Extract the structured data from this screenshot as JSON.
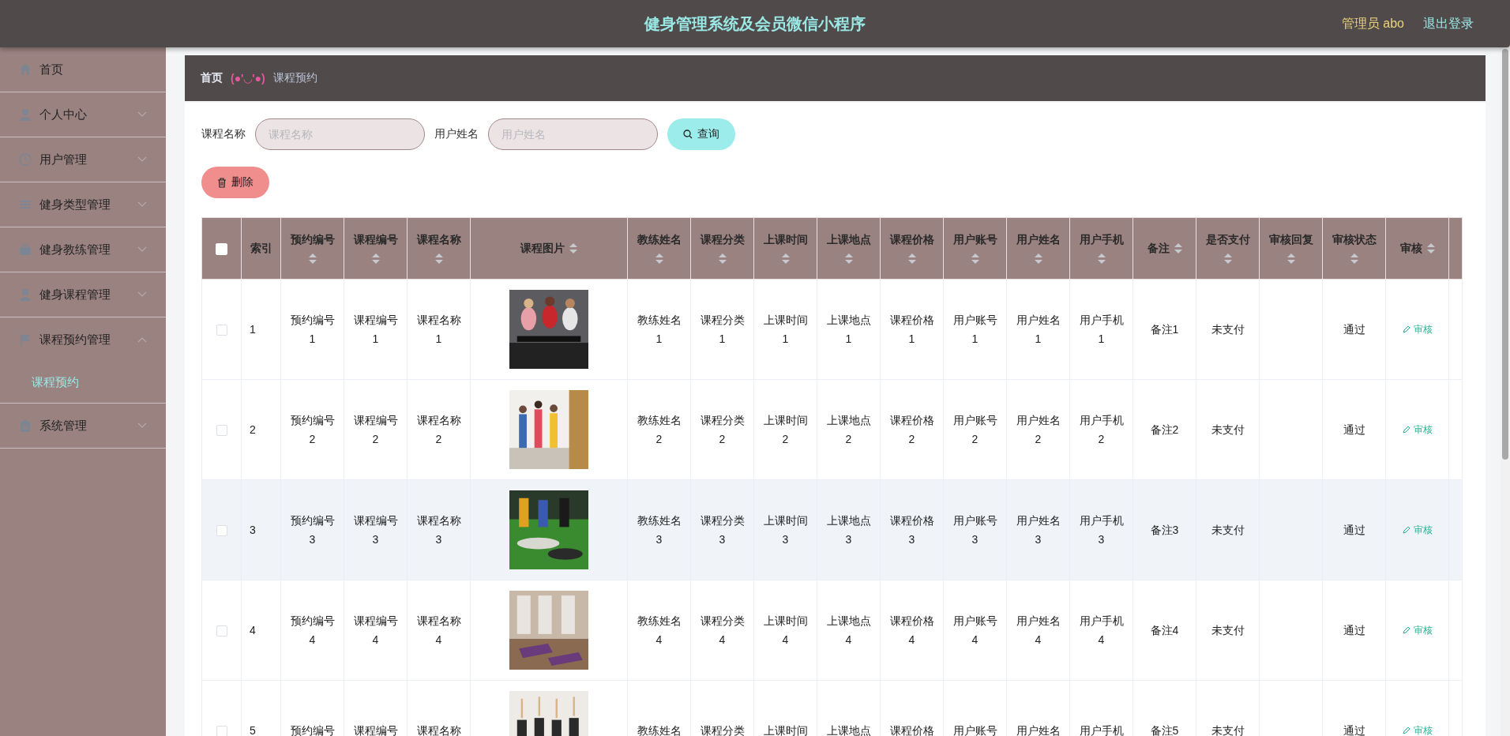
{
  "header": {
    "title": "健身管理系统及会员微信小程序",
    "user": "管理员 abo",
    "logout": "退出登录"
  },
  "sidebar": {
    "items": [
      {
        "label": "首页",
        "kind": "link"
      },
      {
        "label": "个人中心",
        "kind": "menu",
        "expanded": false
      },
      {
        "label": "用户管理",
        "kind": "menu",
        "expanded": false
      },
      {
        "label": "健身类型管理",
        "kind": "menu",
        "expanded": false
      },
      {
        "label": "健身教练管理",
        "kind": "menu",
        "expanded": false
      },
      {
        "label": "健身课程管理",
        "kind": "menu",
        "expanded": false
      },
      {
        "label": "课程预约管理",
        "kind": "menu",
        "expanded": true,
        "children": [
          {
            "label": "课程预约",
            "selected": true
          }
        ]
      },
      {
        "label": "系统管理",
        "kind": "menu",
        "expanded": false
      }
    ]
  },
  "breadcrumb": {
    "home": "首页",
    "separator": "(●'◡'●)",
    "current": "课程预约"
  },
  "search": {
    "fields": [
      {
        "label": "课程名称",
        "placeholder": "课程名称"
      },
      {
        "label": "用户姓名",
        "placeholder": "用户姓名"
      }
    ],
    "button": "查询"
  },
  "actions": {
    "delete": "删除"
  },
  "table": {
    "select_all_checked": false,
    "columns": [
      {
        "kind": "select"
      },
      {
        "kind": "text",
        "label": "索引",
        "sortable": false
      },
      {
        "kind": "text",
        "label": "预约编号",
        "sortable": true
      },
      {
        "kind": "text",
        "label": "课程编号",
        "sortable": true
      },
      {
        "kind": "text",
        "label": "课程名称",
        "sortable": true
      },
      {
        "kind": "picture",
        "label": "课程图片",
        "sortable": true
      },
      {
        "kind": "text",
        "label": "教练姓名",
        "sortable": true
      },
      {
        "kind": "text",
        "label": "课程分类",
        "sortable": true
      },
      {
        "kind": "text",
        "label": "上课时间",
        "sortable": true
      },
      {
        "kind": "text",
        "label": "上课地点",
        "sortable": true
      },
      {
        "kind": "text",
        "label": "课程价格",
        "sortable": true
      },
      {
        "kind": "text",
        "label": "用户账号",
        "sortable": true
      },
      {
        "kind": "text",
        "label": "用户姓名",
        "sortable": true
      },
      {
        "kind": "text",
        "label": "用户手机",
        "sortable": true
      },
      {
        "kind": "text",
        "label": "备注",
        "sortable": true
      },
      {
        "kind": "text",
        "label": "是否支付",
        "sortable": true
      },
      {
        "kind": "text",
        "label": "审核回复",
        "sortable": true
      },
      {
        "kind": "text",
        "label": "审核状态",
        "sortable": true
      },
      {
        "kind": "action",
        "label": "审核",
        "sortable": true
      }
    ],
    "rows": [
      {
        "checked": false,
        "hovered": false,
        "cells": [
          null,
          "1",
          "预约编号 1",
          "课程编号 1",
          "课程名称 1",
          {
            "kind": "picture"
          },
          "教练姓名 1",
          "课程分类 1",
          "上课时间 1",
          "上课地点 1",
          "课程价格 1",
          "用户账号 1",
          "用户姓名 1",
          "用户手机 1",
          "备注1",
          "未支付",
          null,
          "通过",
          "审核"
        ]
      },
      {
        "checked": false,
        "hovered": false,
        "cells": [
          null,
          "2",
          "预约编号 2",
          "课程编号 2",
          "课程名称 2",
          {
            "kind": "picture"
          },
          "教练姓名 2",
          "课程分类 2",
          "上课时间 2",
          "上课地点 2",
          "课程价格 2",
          "用户账号 2",
          "用户姓名 2",
          "用户手机 2",
          "备注2",
          "未支付",
          null,
          "通过",
          "审核"
        ]
      },
      {
        "checked": false,
        "hovered": true,
        "cells": [
          null,
          "3",
          "预约编号 3",
          "课程编号 3",
          "课程名称 3",
          {
            "kind": "picture"
          },
          "教练姓名 3",
          "课程分类 3",
          "上课时间 3",
          "上课地点 3",
          "课程价格 3",
          "用户账号 3",
          "用户姓名 3",
          "用户手机 3",
          "备注3",
          "未支付",
          null,
          "通过",
          "审核"
        ]
      },
      {
        "checked": false,
        "hovered": false,
        "cells": [
          null,
          "4",
          "预约编号 4",
          "课程编号 4",
          "课程名称 4",
          {
            "kind": "picture"
          },
          "教练姓名 4",
          "课程分类 4",
          "上课时间 4",
          "上课地点 4",
          "课程价格 4",
          "用户账号 4",
          "用户姓名 4",
          "用户手机 4",
          "备注4",
          "未支付",
          null,
          "通过",
          "审核"
        ]
      },
      {
        "checked": false,
        "hovered": false,
        "cells": [
          null,
          "5",
          "预约编号",
          "课程编号",
          "课程名称",
          {
            "kind": "picture"
          },
          "教练姓名",
          "课程分类",
          "上课时间",
          "上课地点",
          "课程价格",
          "用户账号",
          "用户姓名",
          "用户手机",
          "备注5",
          "未支付",
          null,
          "通过",
          "审核"
        ]
      }
    ]
  }
}
